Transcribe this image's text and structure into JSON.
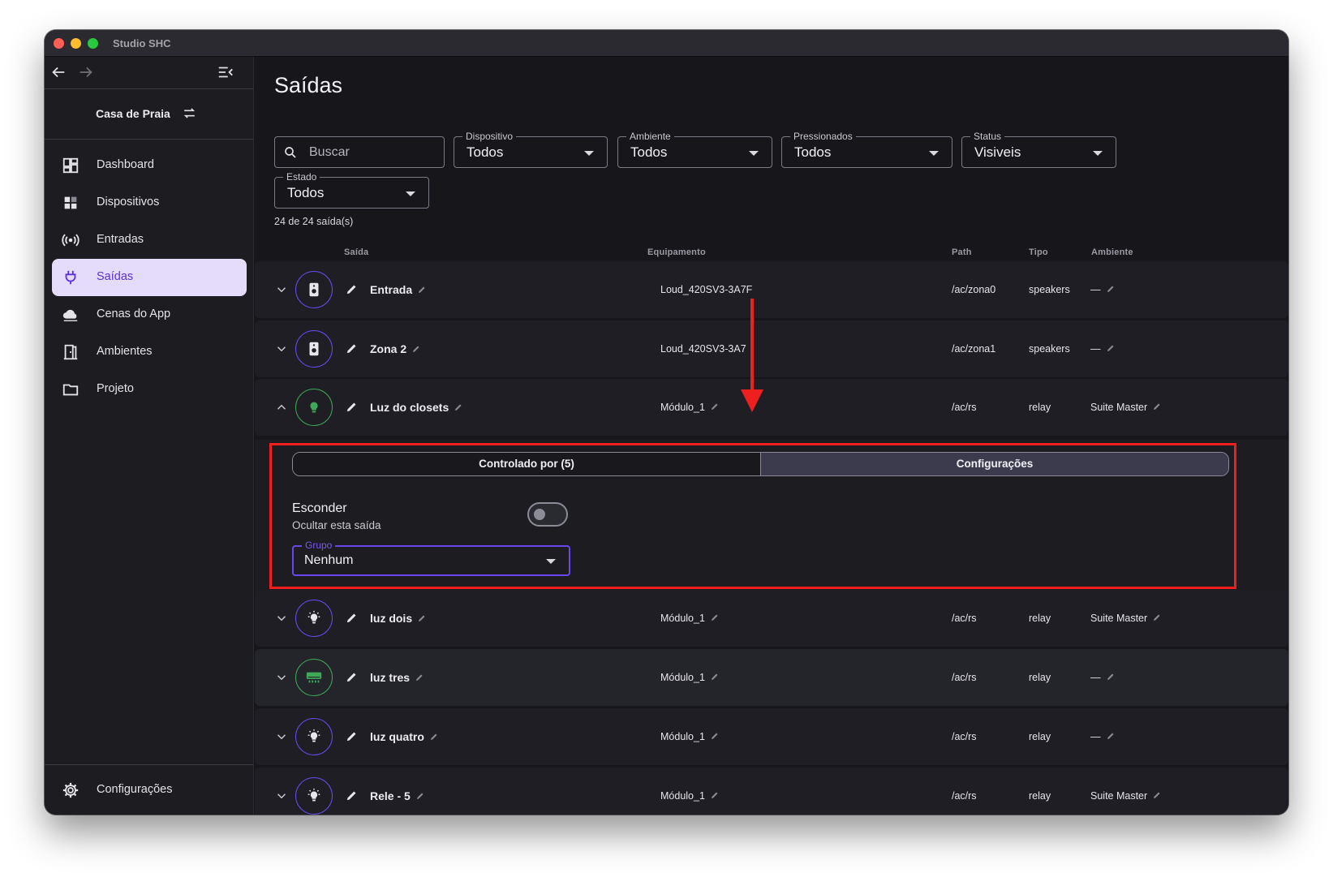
{
  "window": {
    "title": "Studio SHC"
  },
  "sidebar": {
    "house": "Casa de Praia",
    "items": [
      {
        "label": "Dashboard",
        "icon": "dashboard-icon"
      },
      {
        "label": "Dispositivos",
        "icon": "devices-icon"
      },
      {
        "label": "Entradas",
        "icon": "broadcast-icon"
      },
      {
        "label": "Saídas",
        "icon": "plug-icon",
        "active": true
      },
      {
        "label": "Cenas do App",
        "icon": "cloud-icon"
      },
      {
        "label": "Ambientes",
        "icon": "door-icon"
      },
      {
        "label": "Projeto",
        "icon": "folder-icon"
      }
    ],
    "settings": "Configurações"
  },
  "main": {
    "title": "Saídas",
    "search_placeholder": "Buscar",
    "filters": {
      "dispositivo": {
        "label": "Dispositivo",
        "value": "Todos"
      },
      "ambiente": {
        "label": "Ambiente",
        "value": "Todos"
      },
      "pressionados": {
        "label": "Pressionados",
        "value": "Todos"
      },
      "status": {
        "label": "Status",
        "value": "Visiveis"
      },
      "estado": {
        "label": "Estado",
        "value": "Todos"
      }
    },
    "count": "24 de 24 saída(s)",
    "columns": {
      "saida": "Saída",
      "equipamento": "Equipamento",
      "path": "Path",
      "tipo": "Tipo",
      "ambiente": "Ambiente"
    },
    "rows": [
      {
        "name": "Entrada",
        "equip": "Loud_420SV3-3A7F",
        "path": "/ac/zona0",
        "tipo": "speakers",
        "ambiente": "—",
        "icon": "speaker-icon"
      },
      {
        "name": "Zona 2",
        "equip": "Loud_420SV3-3A7",
        "path": "/ac/zona1",
        "tipo": "speakers",
        "ambiente": "—",
        "icon": "speaker-icon"
      },
      {
        "name": "Luz do closets",
        "equip": "Módulo_1",
        "path": "/ac/rs",
        "tipo": "relay",
        "ambiente": "Suite Master",
        "icon": "bulb-icon"
      },
      {
        "name": "luz dois",
        "equip": "Módulo_1",
        "path": "/ac/rs",
        "tipo": "relay",
        "ambiente": "Suite Master",
        "icon": "bulb-icon"
      },
      {
        "name": "luz tres",
        "equip": "Módulo_1",
        "path": "/ac/rs",
        "tipo": "relay",
        "ambiente": "—",
        "icon": "air-conditioner-icon"
      },
      {
        "name": "luz quatro",
        "equip": "Módulo_1",
        "path": "/ac/rs",
        "tipo": "relay",
        "ambiente": "—",
        "icon": "bulb-icon"
      },
      {
        "name": "Rele - 5",
        "equip": "Módulo_1",
        "path": "/ac/rs",
        "tipo": "relay",
        "ambiente": "Suite Master",
        "icon": "bulb-icon"
      }
    ],
    "expanded": {
      "tab_controlled": "Controlado por (5)",
      "tab_config": "Configurações",
      "hide_title": "Esconder",
      "hide_sub": "Ocultar esta saída",
      "hide_on": false,
      "group_label": "Grupo",
      "group_value": "Nenhum"
    }
  },
  "colors": {
    "accent": "#6a46ef",
    "active_bg": "#e5dcfc",
    "annotation": "#ee1f1f",
    "green": "#3ea956"
  }
}
